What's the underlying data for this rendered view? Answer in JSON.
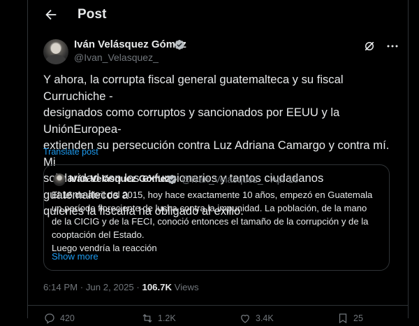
{
  "header": {
    "title": "Post"
  },
  "author": {
    "name": "Iván Velásquez Gómez",
    "handle": "@Ivan_Velasquez_"
  },
  "post": {
    "text": "Y ahora, la corrupta fiscal general guatemalteca y su fiscal Curruchiche -\ndesignados como corruptos y sancionados por EEUU y la UniónEuropea-\nextienden su persecución contra Luz Adriana Camargo y contra mí. Mi\nsolidaridad con los exfuncionarios y tantos ciudadanos guatemaltecos a\nquienes la fiscalía ha obligado al exilio.",
    "translate_label": "Translate post",
    "time": "6:14 PM · Jun 2, 2025 · ",
    "views_count": "106.7K",
    "views_label": " Views"
  },
  "quote": {
    "name": "Iván Velásquez Gómez",
    "meta": "@Ivan_Velasquez_ · Apr 16",
    "text": "El 16 de abril del 2015, hoy hace exactamente 10 años, empezó en Guatemala\nun período floreciente de lucha contra la impunidad. La población, de la mano\nde la CICIG y de la FECI, conoció entonces el tamaño de la corrupción y de la\ncooptación del Estado.\nLuego vendría la reacción",
    "show_more": "Show more"
  },
  "actions": {
    "replies": "420",
    "reposts": "1.2K",
    "likes": "3.4K",
    "bookmarks": "25"
  },
  "colors": {
    "background": "#000000",
    "text": "#e7e9ea",
    "muted": "#71767b",
    "accent": "#1d9bf0",
    "border": "#2f3336"
  },
  "icons": [
    "back-arrow-icon",
    "verified-badge-icon",
    "grok-icon",
    "more-icon",
    "reply-icon",
    "repost-icon",
    "like-icon",
    "bookmark-icon"
  ]
}
